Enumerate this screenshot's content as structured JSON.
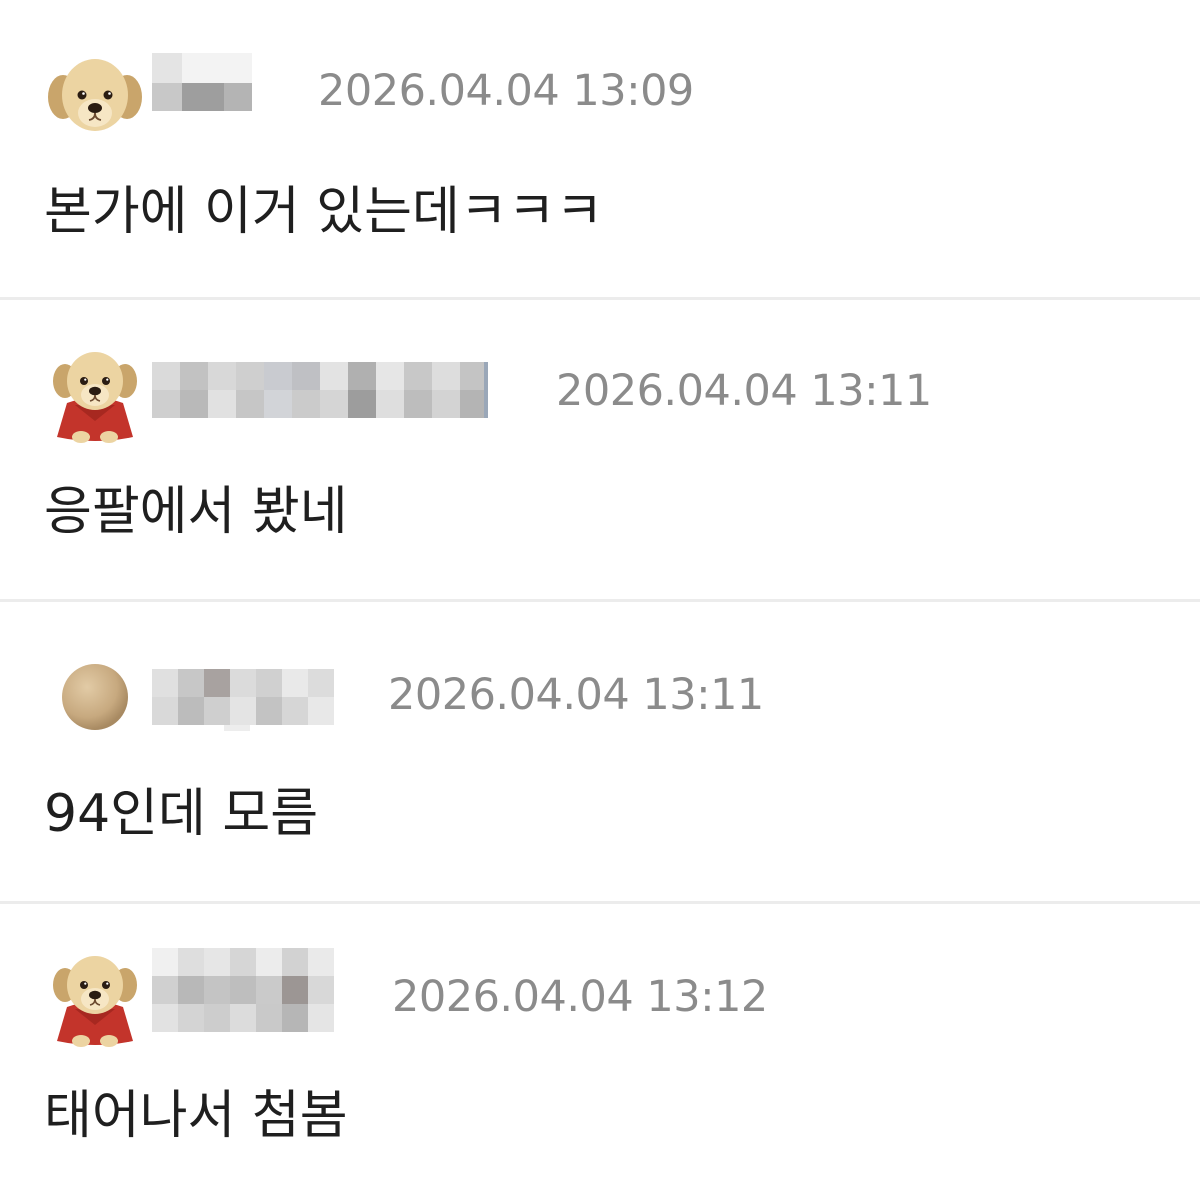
{
  "comments": [
    {
      "avatar_icon": "puppy-face-icon",
      "nickname": "",
      "timestamp": "2026.04.04 13:09",
      "text": "본가에 이거 있는데ㅋㅋㅋ"
    },
    {
      "avatar_icon": "puppy-red-cape-icon",
      "nickname": "",
      "timestamp": "2026.04.04 13:11",
      "text": "응팔에서 봤네"
    },
    {
      "avatar_icon": "beige-circle-icon",
      "nickname": "",
      "timestamp": "2026.04.04 13:11",
      "text": "94인데 모름"
    },
    {
      "avatar_icon": "puppy-red-cape-icon",
      "nickname": "",
      "timestamp": "2026.04.04 13:12",
      "text": "태어나서 첨봄"
    }
  ]
}
